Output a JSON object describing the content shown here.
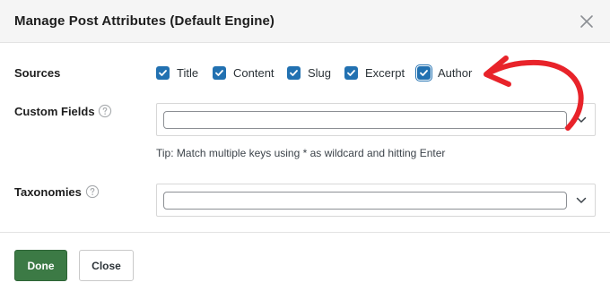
{
  "dialog": {
    "title": "Manage Post Attributes (Default Engine)",
    "close_icon": "close-icon"
  },
  "sources": {
    "label": "Sources",
    "items": [
      {
        "label": "Title",
        "checked": true
      },
      {
        "label": "Content",
        "checked": true
      },
      {
        "label": "Slug",
        "checked": true
      },
      {
        "label": "Excerpt",
        "checked": true
      },
      {
        "label": "Author",
        "checked": true
      }
    ]
  },
  "custom_fields": {
    "label": "Custom Fields",
    "value": "",
    "tip": "Tip: Match multiple keys using * as wildcard and hitting Enter"
  },
  "taxonomies": {
    "label": "Taxonomies",
    "value": ""
  },
  "footer": {
    "done_label": "Done",
    "close_label": "Close"
  },
  "colors": {
    "checkbox": "#2271b1",
    "done_button": "#3c7a45",
    "annotation_arrow": "#e8232a"
  }
}
